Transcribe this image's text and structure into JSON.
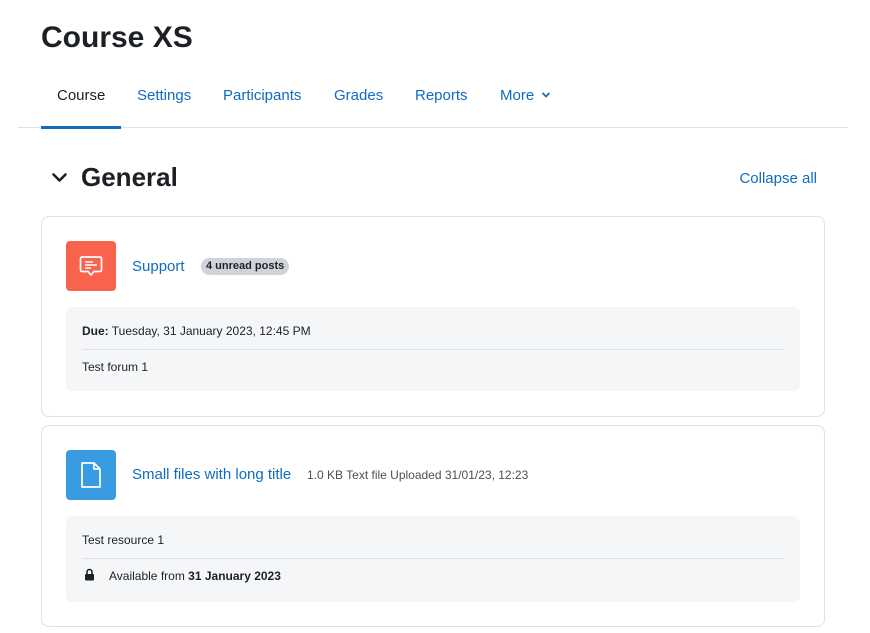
{
  "page": {
    "title": "Course XS"
  },
  "nav": {
    "items": [
      {
        "label": "Course",
        "active": true
      },
      {
        "label": "Settings"
      },
      {
        "label": "Participants"
      },
      {
        "label": "Grades"
      },
      {
        "label": "Reports"
      },
      {
        "label": "More"
      }
    ]
  },
  "section": {
    "title": "General",
    "collapse_all": "Collapse all"
  },
  "activities": [
    {
      "icon": "forum-icon",
      "name": "Support",
      "badge": "4 unread posts",
      "due_label": "Due:",
      "due_value": "Tuesday, 31 January 2023, 12:45 PM",
      "description": "Test forum 1"
    },
    {
      "icon": "file-icon",
      "name": "Small files with long title",
      "meta": "1.0 KB Text file Uploaded 31/01/23, 12:23",
      "description": "Test resource 1",
      "restriction_prefix": "Available from",
      "restriction_date": "31 January 2023"
    }
  ],
  "colors": {
    "accent": "#0f6cbf",
    "forum_icon_bg": "#f7634d",
    "file_icon_bg": "#399be2"
  }
}
